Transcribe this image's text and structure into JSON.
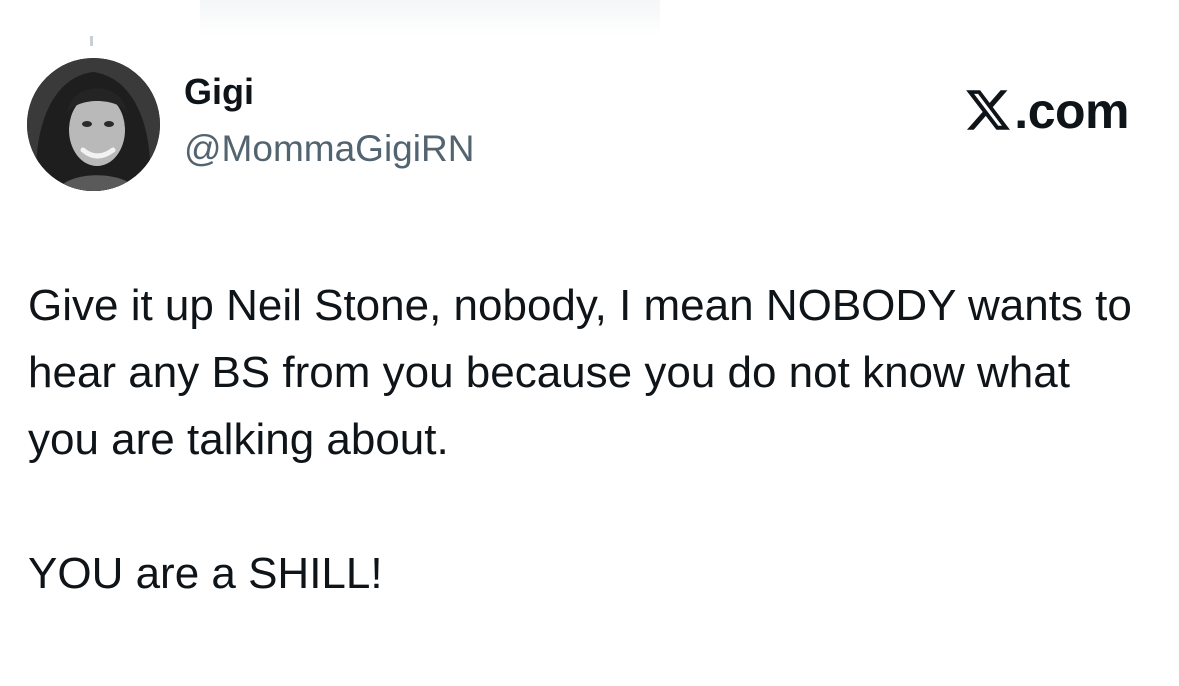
{
  "author": {
    "display_name": "Gigi",
    "handle": "@MommaGigiRN",
    "avatar_icon": "profile-photo"
  },
  "brand": {
    "logo_icon": "x-logo-icon",
    "suffix": ".com"
  },
  "tweet": {
    "paragraph_1": "Give it up Neil Stone, nobody, I mean NOBODY wants to hear any BS from you because you do not know what you are talking about.",
    "paragraph_2": "YOU are a SHILL!"
  },
  "colors": {
    "text_primary": "#0f1419",
    "text_secondary": "#536471",
    "background": "#ffffff"
  }
}
